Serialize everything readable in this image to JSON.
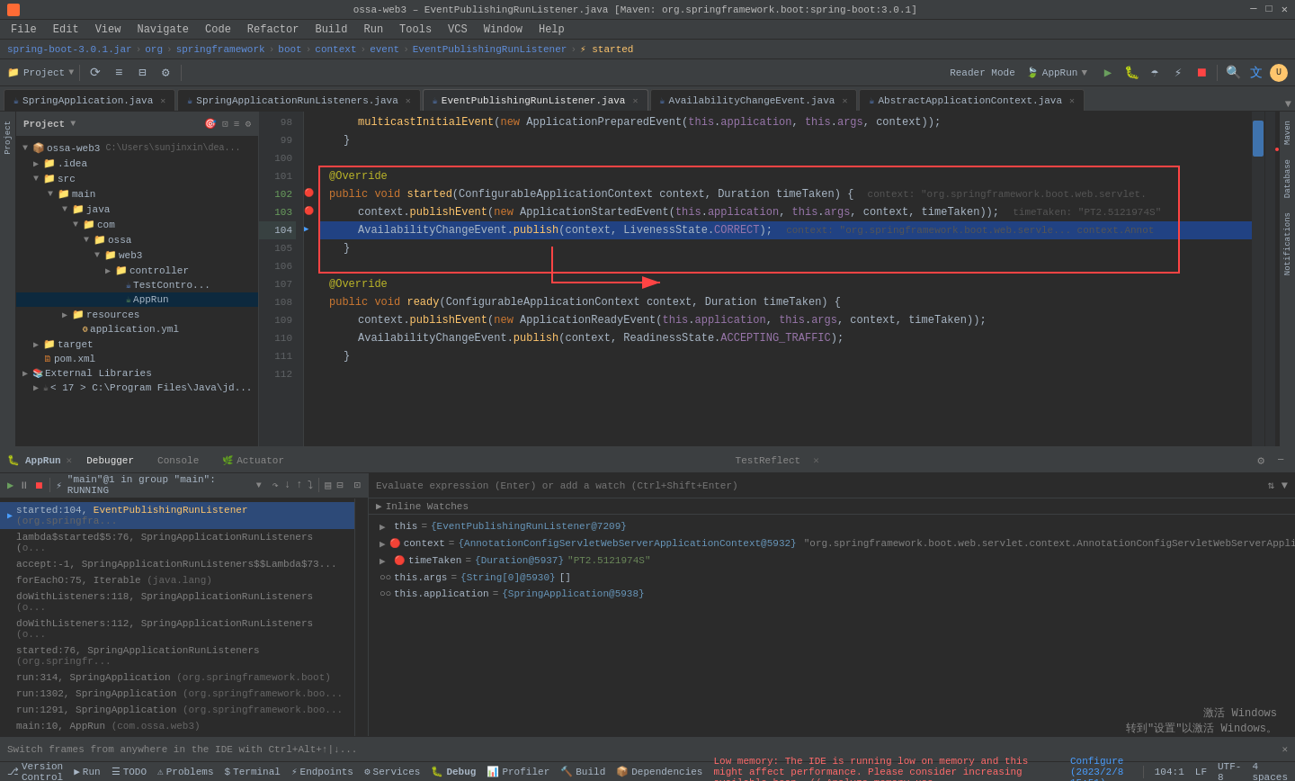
{
  "titleBar": {
    "title": "ossa-web3 – EventPublishingRunListener.java [Maven: org.springframework.boot:spring-boot:3.0.1]",
    "minimize": "─",
    "maximize": "□",
    "close": "✕",
    "logo": "■"
  },
  "menuBar": {
    "items": [
      "File",
      "Edit",
      "View",
      "Navigate",
      "Code",
      "Refactor",
      "Build",
      "Run",
      "Tools",
      "VCS",
      "Window",
      "Help"
    ]
  },
  "breadcrumb": {
    "items": [
      "spring-boot-3.0.1.jar",
      "org",
      "springframework",
      "boot",
      "context",
      "event",
      "EventPublishingRunListener",
      "started"
    ]
  },
  "toolbar": {
    "runConfig": "AppRun",
    "readerMode": "Reader Mode"
  },
  "fileTabs": [
    {
      "name": "SpringApplication.java",
      "color": "#5f8edb",
      "active": false,
      "modified": false
    },
    {
      "name": "SpringApplicationRunListeners.java",
      "color": "#5f8edb",
      "active": false,
      "modified": false
    },
    {
      "name": "EventPublishingRunListener.java",
      "color": "#5f8edb",
      "active": true,
      "modified": false
    },
    {
      "name": "AvailabilityChangeEvent.java",
      "color": "#5f8edb",
      "active": false,
      "modified": false
    },
    {
      "name": "AbstractApplicationContext.java",
      "color": "#5f8edb",
      "active": false,
      "modified": false
    }
  ],
  "projectTree": {
    "root": "Project",
    "items": [
      {
        "label": "ossa-web3",
        "path": "C:\\Users\\sunjinxin\\dea...",
        "indent": 0,
        "type": "module",
        "expanded": true
      },
      {
        "label": ".idea",
        "indent": 1,
        "type": "folder",
        "expanded": false
      },
      {
        "label": "src",
        "indent": 1,
        "type": "folder",
        "expanded": true
      },
      {
        "label": "main",
        "indent": 2,
        "type": "folder",
        "expanded": true
      },
      {
        "label": "java",
        "indent": 3,
        "type": "folder",
        "expanded": true
      },
      {
        "label": "com",
        "indent": 4,
        "type": "folder",
        "expanded": true
      },
      {
        "label": "ossa",
        "indent": 5,
        "type": "folder",
        "expanded": true
      },
      {
        "label": "web3",
        "indent": 6,
        "type": "folder",
        "expanded": true
      },
      {
        "label": "controller",
        "indent": 7,
        "type": "folder",
        "expanded": false
      },
      {
        "label": "TestContro...",
        "indent": 8,
        "type": "java",
        "expanded": false
      },
      {
        "label": "AppRun",
        "indent": 8,
        "type": "java-run",
        "expanded": false,
        "selected": true
      },
      {
        "label": "resources",
        "indent": 3,
        "type": "folder",
        "expanded": false
      },
      {
        "label": "application.yml",
        "indent": 4,
        "type": "yaml",
        "expanded": false
      },
      {
        "label": "target",
        "indent": 1,
        "type": "folder",
        "expanded": false
      },
      {
        "label": "pom.xml",
        "indent": 1,
        "type": "xml",
        "expanded": false
      },
      {
        "label": "External Libraries",
        "indent": 0,
        "type": "lib",
        "expanded": false
      },
      {
        "label": "< 17 > C:\\Program Files\\Java\\jd...",
        "indent": 1,
        "type": "lib-item",
        "expanded": false
      }
    ]
  },
  "codeLines": [
    {
      "num": 98,
      "code": "    multicastInitialEvent(new ApplicationPreparedEvent(this.application, this.args, context));",
      "indent": 2
    },
    {
      "num": 99,
      "code": "}",
      "indent": 1
    },
    {
      "num": 100,
      "code": "",
      "indent": 0
    },
    {
      "num": 101,
      "code": "@Override",
      "indent": 1,
      "type": "annotation"
    },
    {
      "num": 102,
      "code": "public void started(ConfigurableApplicationContext context, Duration timeTaken) {",
      "indent": 1,
      "type": "method"
    },
    {
      "num": 103,
      "code": "    context.publishEvent(new ApplicationStartedEvent(this.application, this.args, context, timeTaken));",
      "indent": 2
    },
    {
      "num": 104,
      "code": "    AvailabilityChangeEvent.publish(context, LivenessState.CORRECT);",
      "indent": 2,
      "highlighted": true
    },
    {
      "num": 105,
      "code": "}",
      "indent": 1
    },
    {
      "num": 106,
      "code": "",
      "indent": 0
    },
    {
      "num": 107,
      "code": "@Override",
      "indent": 1,
      "type": "annotation"
    },
    {
      "num": 108,
      "code": "public void ready(ConfigurableApplicationContext context, Duration timeTaken) {",
      "indent": 1,
      "type": "method"
    },
    {
      "num": 109,
      "code": "    context.publishEvent(new ApplicationReadyEvent(this.application, this.args, context, timeTaken));",
      "indent": 2
    },
    {
      "num": 110,
      "code": "    AvailabilityChangeEvent.publish(context, ReadinessState.ACCEPTING_TRAFFIC);",
      "indent": 2
    },
    {
      "num": 111,
      "code": "}",
      "indent": 1
    },
    {
      "num": 112,
      "code": "",
      "indent": 0
    }
  ],
  "inlineHints": {
    "line102": "context: \"org.springframework.boot.web.servlet.",
    "line103": "timeTaken: \"PT2.5121974S\"",
    "line104": "context: \"org.springframework.boot.web.servle...  context.Annot"
  },
  "debugPanel": {
    "mainTab": "AppRun",
    "tabs": [
      "Debugger",
      "Console",
      "Actuator"
    ],
    "evalPlaceholder": "Evaluate expression (Enter) or add a watch (Ctrl+Shift+Enter)",
    "inlineWatches": "Inline Watches",
    "frames": [
      {
        "label": "started:104, EventPublishingRunListener (org.springfra...",
        "active": true,
        "icon": "▶"
      },
      {
        "label": "lambda$started$5:76, SpringApplicationRunListeners (o...",
        "active": false
      },
      {
        "label": "accept:-1, SpringApplicationRunListeners$$Lambda$73...",
        "active": false
      },
      {
        "label": "forEachO:75, Iterable (java.lang)",
        "active": false
      },
      {
        "label": "doWithListeners:118, SpringApplicationRunListeners (o...",
        "active": false
      },
      {
        "label": "doWithListeners:112, SpringApplicationRunListeners (o...",
        "active": false
      },
      {
        "label": "started:76, SpringApplicationRunListeners (org.springfr...",
        "active": false
      },
      {
        "label": "run:314, SpringApplication (org.springframework.boot)",
        "active": false
      },
      {
        "label": "run:1302, SpringApplication (org.springframework.boo...",
        "active": false
      },
      {
        "label": "run:1291, SpringApplication (org.springframework.boo...",
        "active": false
      },
      {
        "label": "main:10, AppRun (com.ossa.web3)",
        "active": false
      }
    ],
    "threadLabel": "\"main\"@1 in group \"main\": RUNNING",
    "variables": [
      {
        "type": "expand",
        "icon": "▶",
        "name": "this",
        "eq": "=",
        "val": "{EventPublishingRunListener@7209}"
      },
      {
        "type": "expand",
        "icon": "▶",
        "name": "context",
        "eq": "=",
        "val": "{AnnotationConfigServletWebServerApplicationContext@5932}",
        "extra": " \"org.springframework.boot.web.servlet.context.AnnotationConfigServletWebServerAppli...",
        "hasView": true
      },
      {
        "type": "item",
        "icon": "▶",
        "name": "timeTaken",
        "eq": "=",
        "val": "{Duration@5937}",
        "strVal": " \"PT2.5121974S\""
      },
      {
        "type": "item",
        "icon": "○○",
        "name": "this.args",
        "eq": "=",
        "val": "{String[0]@5930} []"
      },
      {
        "type": "item",
        "icon": "○○",
        "name": "this.application",
        "eq": "=",
        "val": "{SpringApplication@5938}"
      }
    ]
  },
  "statusBar": {
    "vcs": "Version Control",
    "run": "Run",
    "todo": "TODO",
    "problems": "Problems",
    "terminal": "Terminal",
    "endpoints": "Endpoints",
    "services": "Services",
    "debug": "Debug",
    "profiler": "Profiler",
    "build": "Build",
    "dependencies": "Dependencies",
    "warning": "Low memory: The IDE is running low on memory and this might affect performance. Please consider increasing available heap. // Analyze memory use",
    "configure": "Configure (2023/2/8 15:51)",
    "pos": "104:1",
    "lf": "LF",
    "encoding": "UTF-8",
    "indent": "4 spaces"
  },
  "windowsActivation": {
    "line1": "激活 Windows",
    "line2": "转到\"设置\"以激活 Windows。"
  }
}
